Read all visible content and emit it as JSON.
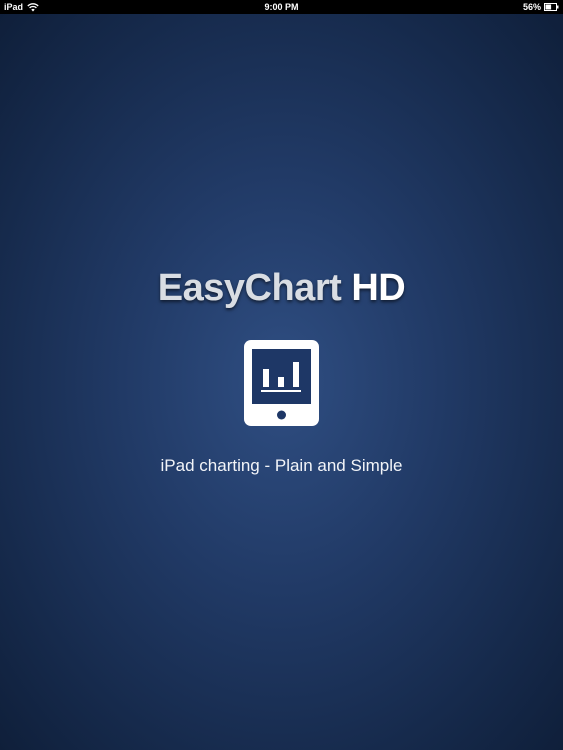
{
  "status_bar": {
    "carrier": "iPad",
    "time": "9:00 PM",
    "battery_percent": "56%",
    "battery_level": 0.56,
    "wifi_icon": "wifi-icon",
    "battery_icon": "battery-icon"
  },
  "splash": {
    "title_main": "EasyChart",
    "title_accent": "HD",
    "logo_icon": "tablet-chart-icon",
    "tagline": "iPad charting - Plain and Simple",
    "colors": {
      "background_center": "#2f4e82",
      "background_edge": "#0f1f3a",
      "title_main": "#d9dde3",
      "title_accent": "#ffffff",
      "icon": "#ffffff"
    }
  }
}
